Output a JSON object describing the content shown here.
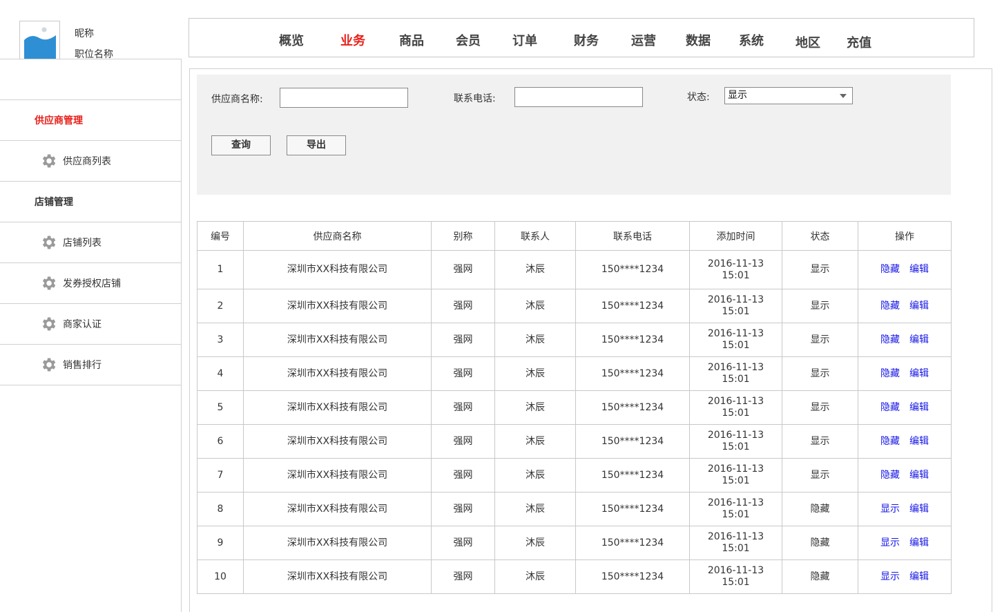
{
  "profile": {
    "nickname": "昵称",
    "job_title": "职位名称"
  },
  "top_nav": {
    "items": [
      "概览",
      "业务",
      "商品",
      "会员",
      "订单",
      "财务",
      "运营",
      "数据",
      "系统",
      "地区",
      "充值"
    ],
    "active": "业务"
  },
  "sidebar": {
    "items": [
      {
        "label": "供应商管理",
        "type": "group",
        "active": true
      },
      {
        "label": "供应商列表",
        "type": "sub",
        "icon": "gear-icon"
      },
      {
        "label": "店铺管理",
        "type": "group"
      },
      {
        "label": "店铺列表",
        "type": "sub",
        "icon": "gear-icon"
      },
      {
        "label": "发券授权店铺",
        "type": "sub",
        "icon": "gear-icon"
      },
      {
        "label": "商家认证",
        "type": "sub",
        "icon": "gear-icon"
      },
      {
        "label": "销售排行",
        "type": "sub",
        "icon": "gear-icon"
      }
    ]
  },
  "filter": {
    "supplier_label": "供应商名称:",
    "supplier_value": "",
    "phone_label": "联系电话:",
    "phone_value": "",
    "status_label": "状态:",
    "status_value": "显示",
    "query_button": "查询",
    "export_button": "导出"
  },
  "table": {
    "headers": [
      "编号",
      "供应商名称",
      "别称",
      "联系人",
      "联系电话",
      "添加时间",
      "状态",
      "操作"
    ],
    "rows": [
      {
        "id": "1",
        "name": "深圳市XX科技有限公司",
        "alias": "强网",
        "contact": "沐辰",
        "phone": "150****1234",
        "date": "2016-11-13",
        "time": "15:01",
        "status": "显示",
        "action1": "隐藏",
        "action2": "编辑"
      },
      {
        "id": "2",
        "name": "深圳市XX科技有限公司",
        "alias": "强网",
        "contact": "沐辰",
        "phone": "150****1234",
        "date": "2016-11-13",
        "time": "15:01",
        "status": "显示",
        "action1": "隐藏",
        "action2": "编辑"
      },
      {
        "id": "3",
        "name": "深圳市XX科技有限公司",
        "alias": "强网",
        "contact": "沐辰",
        "phone": "150****1234",
        "date": "2016-11-13",
        "time": "15:01",
        "status": "显示",
        "action1": "隐藏",
        "action2": "编辑"
      },
      {
        "id": "4",
        "name": "深圳市XX科技有限公司",
        "alias": "强网",
        "contact": "沐辰",
        "phone": "150****1234",
        "date": "2016-11-13",
        "time": "15:01",
        "status": "显示",
        "action1": "隐藏",
        "action2": "编辑"
      },
      {
        "id": "5",
        "name": "深圳市XX科技有限公司",
        "alias": "强网",
        "contact": "沐辰",
        "phone": "150****1234",
        "date": "2016-11-13",
        "time": "15:01",
        "status": "显示",
        "action1": "隐藏",
        "action2": "编辑"
      },
      {
        "id": "6",
        "name": "深圳市XX科技有限公司",
        "alias": "强网",
        "contact": "沐辰",
        "phone": "150****1234",
        "date": "2016-11-13",
        "time": "15:01",
        "status": "显示",
        "action1": "隐藏",
        "action2": "编辑"
      },
      {
        "id": "7",
        "name": "深圳市XX科技有限公司",
        "alias": "强网",
        "contact": "沐辰",
        "phone": "150****1234",
        "date": "2016-11-13",
        "time": "15:01",
        "status": "显示",
        "action1": "隐藏",
        "action2": "编辑"
      },
      {
        "id": "8",
        "name": "深圳市XX科技有限公司",
        "alias": "强网",
        "contact": "沐辰",
        "phone": "150****1234",
        "date": "2016-11-13",
        "time": "15:01",
        "status": "隐藏",
        "action1": "显示",
        "action2": "编辑"
      },
      {
        "id": "9",
        "name": "深圳市XX科技有限公司",
        "alias": "强网",
        "contact": "沐辰",
        "phone": "150****1234",
        "date": "2016-11-13",
        "time": "15:01",
        "status": "隐藏",
        "action1": "显示",
        "action2": "编辑"
      },
      {
        "id": "10",
        "name": "深圳市XX科技有限公司",
        "alias": "强网",
        "contact": "沐辰",
        "phone": "150****1234",
        "date": "2016-11-13",
        "time": "15:01",
        "status": "隐藏",
        "action1": "显示",
        "action2": "编辑"
      }
    ]
  },
  "colors": {
    "accent": "#e8201a",
    "link": "#1515e6",
    "filter_bg": "#f1f1f1",
    "avatar_blue": "#2f8fd4"
  }
}
